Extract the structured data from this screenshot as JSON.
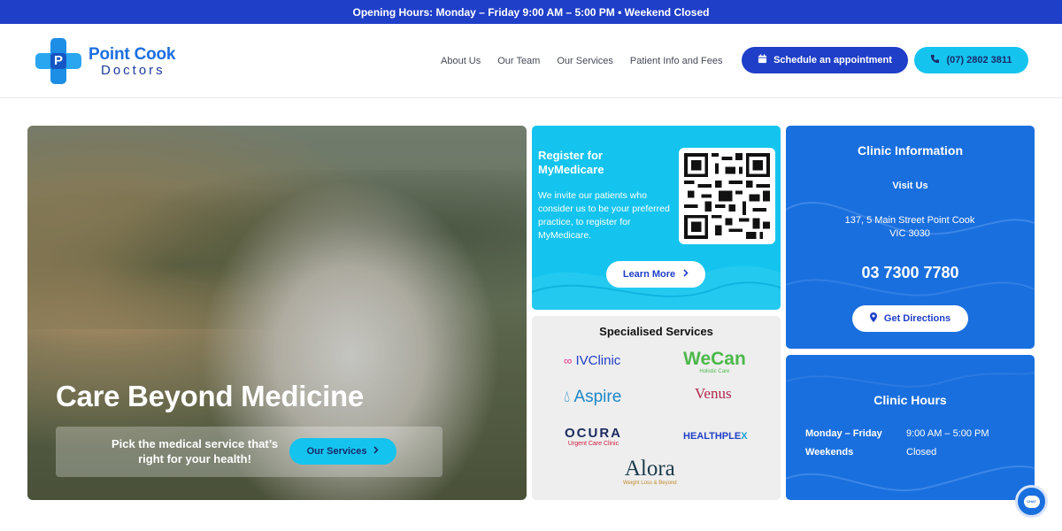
{
  "topbar": {
    "text": "Opening Hours: Monday – Friday 9:00 AM – 5:00 PM • Weekend Closed"
  },
  "logo": {
    "line1": "Point Cook",
    "line2": "Doctors",
    "mark": "P"
  },
  "nav": {
    "items": [
      "About Us",
      "Our Team",
      "Our Services",
      "Patient Info and Fees"
    ],
    "schedule_label": "Schedule an appointment",
    "schedule_icon": "calendar-icon",
    "phone_label": "(07) 2802 3811",
    "phone_icon": "phone-icon"
  },
  "hero": {
    "title": "Care Beyond Medicine",
    "pick_text": "Pick the medical service that’s right for your health!",
    "button_label": "Our Services",
    "button_icon": "chevron-right-icon"
  },
  "medicare": {
    "title": "Register for MyMedicare",
    "body": "We invite our patients who consider us to be your preferred practice, to register for MyMedicare.",
    "button_label": "Learn More",
    "button_icon": "chevron-right-icon"
  },
  "special": {
    "title": "Specialised Services",
    "brands": {
      "ivclinic": "IVClinic",
      "wecan": "WeCan",
      "wecan_sub": "Holistic Care",
      "aspire": "Aspire",
      "venus": "Venus",
      "ocura": "OCURA",
      "ocura_sub": "Urgent Care Clinic",
      "health_a": "HEALTHPLE",
      "health_b": "X",
      "alora": "Alora",
      "alora_sub": "Weight Loss & Beyond"
    }
  },
  "info": {
    "title": "Clinic Information",
    "visit": "Visit Us",
    "addr1": "137, 5 Main Street Point Cook",
    "addr2": "VIC 3030",
    "phone": "03 7300 7780",
    "button_label": "Get Directions",
    "button_icon": "map-pin-icon"
  },
  "hours": {
    "title": "Clinic Hours",
    "rows": [
      {
        "day": "Monday – Friday",
        "time": "9:00 AM – 5:00 PM"
      },
      {
        "day": "Weekends",
        "time": "Closed"
      }
    ]
  },
  "chat": {
    "label": "CHAT"
  },
  "colors": {
    "brand_blue": "#1f3fc8",
    "cyan": "#14c4ee",
    "card_blue": "#1a6fde"
  }
}
